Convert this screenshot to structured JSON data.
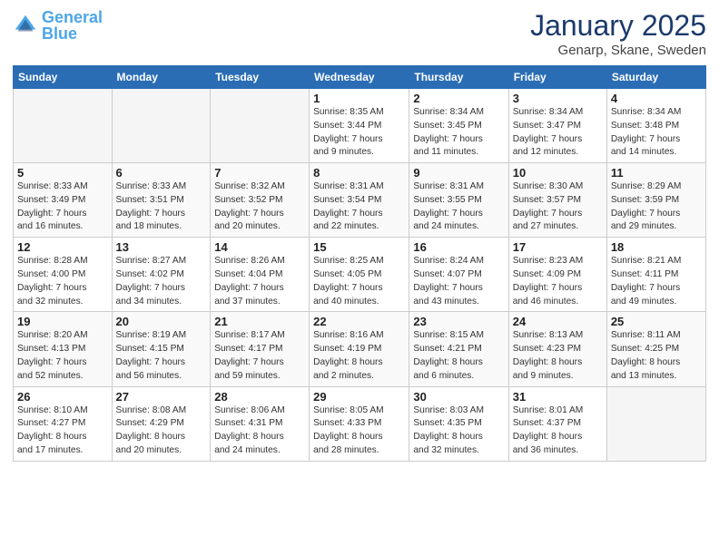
{
  "header": {
    "logo_general": "General",
    "logo_blue": "Blue",
    "main_title": "January 2025",
    "subtitle": "Genarp, Skane, Sweden"
  },
  "calendar": {
    "days_of_week": [
      "Sunday",
      "Monday",
      "Tuesday",
      "Wednesday",
      "Thursday",
      "Friday",
      "Saturday"
    ],
    "weeks": [
      [
        {
          "day": "",
          "info": ""
        },
        {
          "day": "",
          "info": ""
        },
        {
          "day": "",
          "info": ""
        },
        {
          "day": "1",
          "info": "Sunrise: 8:35 AM\nSunset: 3:44 PM\nDaylight: 7 hours\nand 9 minutes."
        },
        {
          "day": "2",
          "info": "Sunrise: 8:34 AM\nSunset: 3:45 PM\nDaylight: 7 hours\nand 11 minutes."
        },
        {
          "day": "3",
          "info": "Sunrise: 8:34 AM\nSunset: 3:47 PM\nDaylight: 7 hours\nand 12 minutes."
        },
        {
          "day": "4",
          "info": "Sunrise: 8:34 AM\nSunset: 3:48 PM\nDaylight: 7 hours\nand 14 minutes."
        }
      ],
      [
        {
          "day": "5",
          "info": "Sunrise: 8:33 AM\nSunset: 3:49 PM\nDaylight: 7 hours\nand 16 minutes."
        },
        {
          "day": "6",
          "info": "Sunrise: 8:33 AM\nSunset: 3:51 PM\nDaylight: 7 hours\nand 18 minutes."
        },
        {
          "day": "7",
          "info": "Sunrise: 8:32 AM\nSunset: 3:52 PM\nDaylight: 7 hours\nand 20 minutes."
        },
        {
          "day": "8",
          "info": "Sunrise: 8:31 AM\nSunset: 3:54 PM\nDaylight: 7 hours\nand 22 minutes."
        },
        {
          "day": "9",
          "info": "Sunrise: 8:31 AM\nSunset: 3:55 PM\nDaylight: 7 hours\nand 24 minutes."
        },
        {
          "day": "10",
          "info": "Sunrise: 8:30 AM\nSunset: 3:57 PM\nDaylight: 7 hours\nand 27 minutes."
        },
        {
          "day": "11",
          "info": "Sunrise: 8:29 AM\nSunset: 3:59 PM\nDaylight: 7 hours\nand 29 minutes."
        }
      ],
      [
        {
          "day": "12",
          "info": "Sunrise: 8:28 AM\nSunset: 4:00 PM\nDaylight: 7 hours\nand 32 minutes."
        },
        {
          "day": "13",
          "info": "Sunrise: 8:27 AM\nSunset: 4:02 PM\nDaylight: 7 hours\nand 34 minutes."
        },
        {
          "day": "14",
          "info": "Sunrise: 8:26 AM\nSunset: 4:04 PM\nDaylight: 7 hours\nand 37 minutes."
        },
        {
          "day": "15",
          "info": "Sunrise: 8:25 AM\nSunset: 4:05 PM\nDaylight: 7 hours\nand 40 minutes."
        },
        {
          "day": "16",
          "info": "Sunrise: 8:24 AM\nSunset: 4:07 PM\nDaylight: 7 hours\nand 43 minutes."
        },
        {
          "day": "17",
          "info": "Sunrise: 8:23 AM\nSunset: 4:09 PM\nDaylight: 7 hours\nand 46 minutes."
        },
        {
          "day": "18",
          "info": "Sunrise: 8:21 AM\nSunset: 4:11 PM\nDaylight: 7 hours\nand 49 minutes."
        }
      ],
      [
        {
          "day": "19",
          "info": "Sunrise: 8:20 AM\nSunset: 4:13 PM\nDaylight: 7 hours\nand 52 minutes."
        },
        {
          "day": "20",
          "info": "Sunrise: 8:19 AM\nSunset: 4:15 PM\nDaylight: 7 hours\nand 56 minutes."
        },
        {
          "day": "21",
          "info": "Sunrise: 8:17 AM\nSunset: 4:17 PM\nDaylight: 7 hours\nand 59 minutes."
        },
        {
          "day": "22",
          "info": "Sunrise: 8:16 AM\nSunset: 4:19 PM\nDaylight: 8 hours\nand 2 minutes."
        },
        {
          "day": "23",
          "info": "Sunrise: 8:15 AM\nSunset: 4:21 PM\nDaylight: 8 hours\nand 6 minutes."
        },
        {
          "day": "24",
          "info": "Sunrise: 8:13 AM\nSunset: 4:23 PM\nDaylight: 8 hours\nand 9 minutes."
        },
        {
          "day": "25",
          "info": "Sunrise: 8:11 AM\nSunset: 4:25 PM\nDaylight: 8 hours\nand 13 minutes."
        }
      ],
      [
        {
          "day": "26",
          "info": "Sunrise: 8:10 AM\nSunset: 4:27 PM\nDaylight: 8 hours\nand 17 minutes."
        },
        {
          "day": "27",
          "info": "Sunrise: 8:08 AM\nSunset: 4:29 PM\nDaylight: 8 hours\nand 20 minutes."
        },
        {
          "day": "28",
          "info": "Sunrise: 8:06 AM\nSunset: 4:31 PM\nDaylight: 8 hours\nand 24 minutes."
        },
        {
          "day": "29",
          "info": "Sunrise: 8:05 AM\nSunset: 4:33 PM\nDaylight: 8 hours\nand 28 minutes."
        },
        {
          "day": "30",
          "info": "Sunrise: 8:03 AM\nSunset: 4:35 PM\nDaylight: 8 hours\nand 32 minutes."
        },
        {
          "day": "31",
          "info": "Sunrise: 8:01 AM\nSunset: 4:37 PM\nDaylight: 8 hours\nand 36 minutes."
        },
        {
          "day": "",
          "info": ""
        }
      ]
    ]
  }
}
